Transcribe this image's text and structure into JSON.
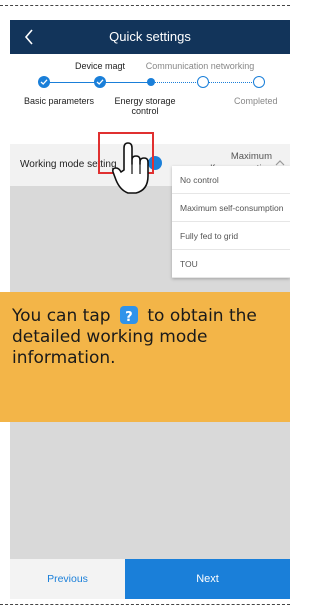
{
  "header": {
    "title": "Quick settings",
    "back_icon": "chevron-left-icon"
  },
  "stepper": {
    "top_labels": [
      "Device magt",
      "Communication networking"
    ],
    "bottom_labels": [
      "Basic parameters",
      "Energy storage control",
      "Completed"
    ]
  },
  "setting": {
    "label": "Working mode setting",
    "value_line1": "Maximum",
    "value_line2": "self-consumption",
    "chevron_icon": "chevron-up-icon",
    "help_icon": "help-icon"
  },
  "dropdown": {
    "options": [
      "No control",
      "Maximum self-consumption",
      "Fully fed to grid",
      "TOU"
    ]
  },
  "tip": {
    "text_before": "You can tap",
    "icon_glyph": "?",
    "text_after": "to obtain the detailed working mode information."
  },
  "footer": {
    "previous_label": "Previous",
    "next_label": "Next"
  },
  "colors": {
    "accent": "#1a7fd9",
    "appbar": "#12345a",
    "tip_bg": "#f3b548",
    "highlight": "#e03030"
  }
}
